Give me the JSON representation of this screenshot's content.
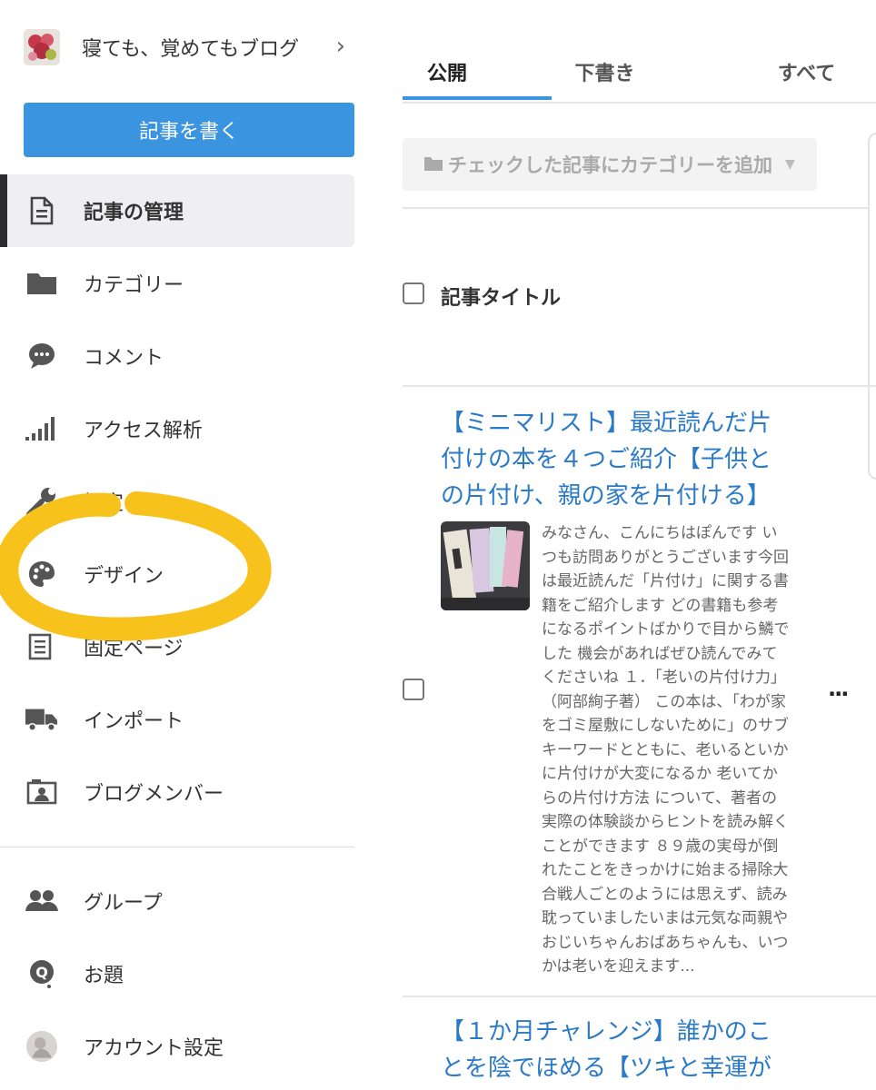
{
  "blog": {
    "title": "寝ても、覚めてもブログ",
    "write_label": "記事を書く"
  },
  "nav": {
    "manage": "記事の管理",
    "category": "カテゴリー",
    "comment": "コメント",
    "access": "アクセス解析",
    "settings": "設定",
    "design": "デザイン",
    "pages": "固定ページ",
    "import": "インポート",
    "members": "ブログメンバー",
    "group": "グループ",
    "theme": "お題",
    "account": "アカウント設定"
  },
  "tabs": {
    "public": "公開",
    "draft": "下書き",
    "all": "すべて"
  },
  "category_add": {
    "label": "チェックした記事にカテゴリーを追加"
  },
  "table": {
    "title_header": "記事タイトル"
  },
  "posts": [
    {
      "title": "【ミニマリスト】最近読んだ片付けの本を４つご紹介【子供との片付け、親の家を片付ける】",
      "excerpt": "みなさん、こんにちはぽんです いつも訪問ありがとうございます今回は最近読んだ「片付け」に関する書籍をご紹介します どの書籍も参考になるポイントばかりで目から鱗でした 機会があればぜひ読んでみてくださいね １．「老いの片付け力」（阿部絢子著） この本は、「わが家をゴミ屋敷にしないために」のサブキーワードとともに、老いるといかに片付けが大変になるか 老いてからの片付け方法 について、著者の実際の体験談からヒントを読み解くことができます ８９歳の実母が倒れたことをきっかけに始まる掃除大合戦人ごとのようには思えず、読み耽っていましたいまは元気な両親やおじいちゃんおばあちゃんも、いつかは老いを迎えます...",
      "more": "..."
    },
    {
      "title": "【１か月チャレンジ】誰かのことを陰でほめる【ツキと幸運が"
    }
  ],
  "colors": {
    "accent": "#3a94e0",
    "link": "#2a7ac7",
    "highlight": "#f8c21c"
  }
}
